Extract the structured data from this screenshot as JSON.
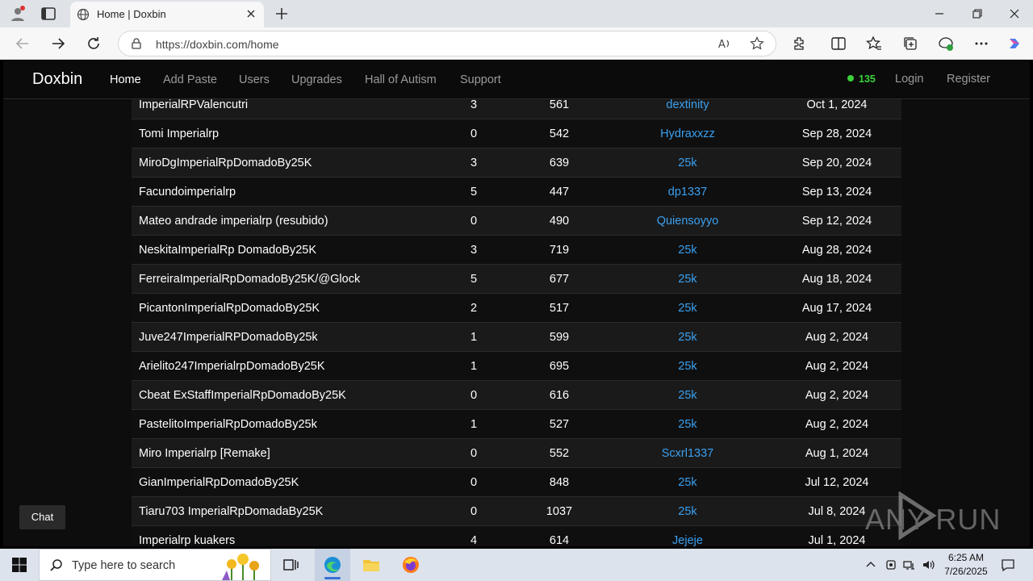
{
  "browser": {
    "tab_title": "Home | Doxbin",
    "url": "https://doxbin.com/home"
  },
  "site": {
    "brand": "Doxbin",
    "nav": [
      "Home",
      "Add Paste",
      "Users",
      "Upgrades",
      "Hall of Autism",
      "Support"
    ],
    "active_nav": "Home",
    "online_count": "135",
    "login_label": "Login",
    "register_label": "Register",
    "chat_label": "Chat",
    "accent_color": "#3aa0f0",
    "online_color": "#3ad13a"
  },
  "pastes": [
    {
      "title": "ImperialRPValencutri",
      "comments": "3",
      "views": "561",
      "user": "dextinity",
      "date": "Oct 1, 2024"
    },
    {
      "title": "Tomi Imperialrp",
      "comments": "0",
      "views": "542",
      "user": "Hydraxxzz",
      "date": "Sep 28, 2024"
    },
    {
      "title": "MiroDgImperialRpDomadoBy25K",
      "comments": "3",
      "views": "639",
      "user": "25k",
      "date": "Sep 20, 2024"
    },
    {
      "title": "Facundoimperialrp",
      "comments": "5",
      "views": "447",
      "user": "dp1337",
      "date": "Sep 13, 2024"
    },
    {
      "title": "Mateo andrade imperialrp (resubido)",
      "comments": "0",
      "views": "490",
      "user": "Quiensoyyo",
      "date": "Sep 12, 2024"
    },
    {
      "title": "NeskitaImperialRp DomadoBy25K",
      "comments": "3",
      "views": "719",
      "user": "25k",
      "date": "Aug 28, 2024"
    },
    {
      "title": "FerreiraImperialRpDomadoBy25K/@Glock",
      "comments": "5",
      "views": "677",
      "user": "25k",
      "date": "Aug 18, 2024"
    },
    {
      "title": "PicantonImperialRpDomadoBy25K",
      "comments": "2",
      "views": "517",
      "user": "25k",
      "date": "Aug 17, 2024"
    },
    {
      "title": "Juve247ImperialRPDomadoBy25k",
      "comments": "1",
      "views": "599",
      "user": "25k",
      "date": "Aug 2, 2024"
    },
    {
      "title": "Arielito247ImperialrpDomadoBy25K",
      "comments": "1",
      "views": "695",
      "user": "25k",
      "date": "Aug 2, 2024"
    },
    {
      "title": "Cbeat ExStaffImperialRpDomadoBy25K",
      "comments": "0",
      "views": "616",
      "user": "25k",
      "date": "Aug 2, 2024"
    },
    {
      "title": "PastelitoImperialRpDomadoBy25k",
      "comments": "1",
      "views": "527",
      "user": "25k",
      "date": "Aug 2, 2024"
    },
    {
      "title": "Miro Imperialrp [Remake]",
      "comments": "0",
      "views": "552",
      "user": "Scxrl1337",
      "date": "Aug 1, 2024"
    },
    {
      "title": "GianImperialRpDomadoBy25K",
      "comments": "0",
      "views": "848",
      "user": "25k",
      "date": "Jul 12, 2024"
    },
    {
      "title": "Tiaru703 ImperialRpDomadaBy25K",
      "comments": "0",
      "views": "1037",
      "user": "25k",
      "date": "Jul 8, 2024"
    },
    {
      "title": "Imperialrp kuakers",
      "comments": "4",
      "views": "614",
      "user": "Jejeje",
      "date": "Jul 1, 2024"
    }
  ],
  "watermark": "ANY RUN",
  "taskbar": {
    "search_placeholder": "Type here to search",
    "time": "6:25 AM",
    "date": "7/26/2025"
  }
}
